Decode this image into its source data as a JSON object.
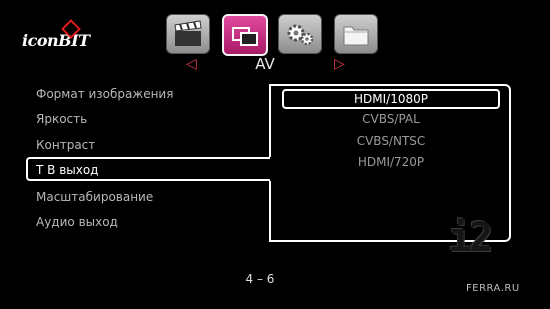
{
  "brand": {
    "logo_text": "iconBIT"
  },
  "toolbar": {
    "tiles": [
      {
        "icon": "clapperboard-icon",
        "active": false
      },
      {
        "icon": "display-settings-icon",
        "active": true
      },
      {
        "icon": "gears-icon",
        "active": false
      },
      {
        "icon": "folder-icon",
        "active": false
      }
    ]
  },
  "section": {
    "title": "AV",
    "prev_glyph": "◁",
    "next_glyph": "▷"
  },
  "menu": {
    "items": [
      {
        "label": "Формат изображения"
      },
      {
        "label": "Яркость"
      },
      {
        "label": "Контраст"
      },
      {
        "label": "Т В выход",
        "selected": true
      },
      {
        "label": "Масштабирование"
      },
      {
        "label": "Аудио выход"
      }
    ]
  },
  "options": {
    "items": [
      {
        "label": "HDMI/1080P",
        "selected": true
      },
      {
        "label": "CVBS/PAL"
      },
      {
        "label": "CVBS/NTSC"
      },
      {
        "label": "HDMI/720P"
      }
    ]
  },
  "pager": {
    "text": "4 – 6"
  },
  "watermark": {
    "logo": "i2",
    "site": "FERRA.RU"
  }
}
